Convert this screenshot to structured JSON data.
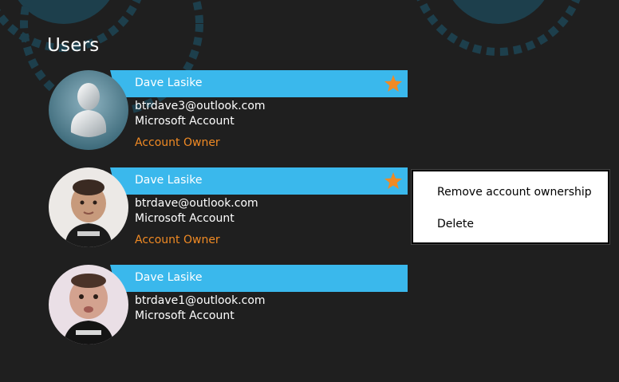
{
  "page": {
    "title": "Users"
  },
  "colors": {
    "background": "#1f1f1f",
    "band": "#3ab8ec",
    "owner": "#f08a24",
    "star": "#f08a24",
    "deco": "#1d3f4c"
  },
  "users": [
    {
      "name": "Dave Lasike",
      "email": "btrdave3@outlook.com",
      "account_type": "Microsoft Account",
      "role": "Account Owner",
      "starred": true,
      "avatar_icon": "default-user-avatar-icon"
    },
    {
      "name": "Dave Lasike",
      "email": "btrdave@outlook.com",
      "account_type": "Microsoft Account",
      "role": "Account Owner",
      "starred": true,
      "avatar_icon": "baby-photo-avatar"
    },
    {
      "name": "Dave Lasike",
      "email": "btrdave1@outlook.com",
      "account_type": "Microsoft Account",
      "role": "",
      "starred": false,
      "avatar_icon": "baby-photo-avatar"
    }
  ],
  "context_menu": {
    "items": [
      {
        "label": "Remove account ownership"
      },
      {
        "label": "Delete"
      }
    ]
  }
}
